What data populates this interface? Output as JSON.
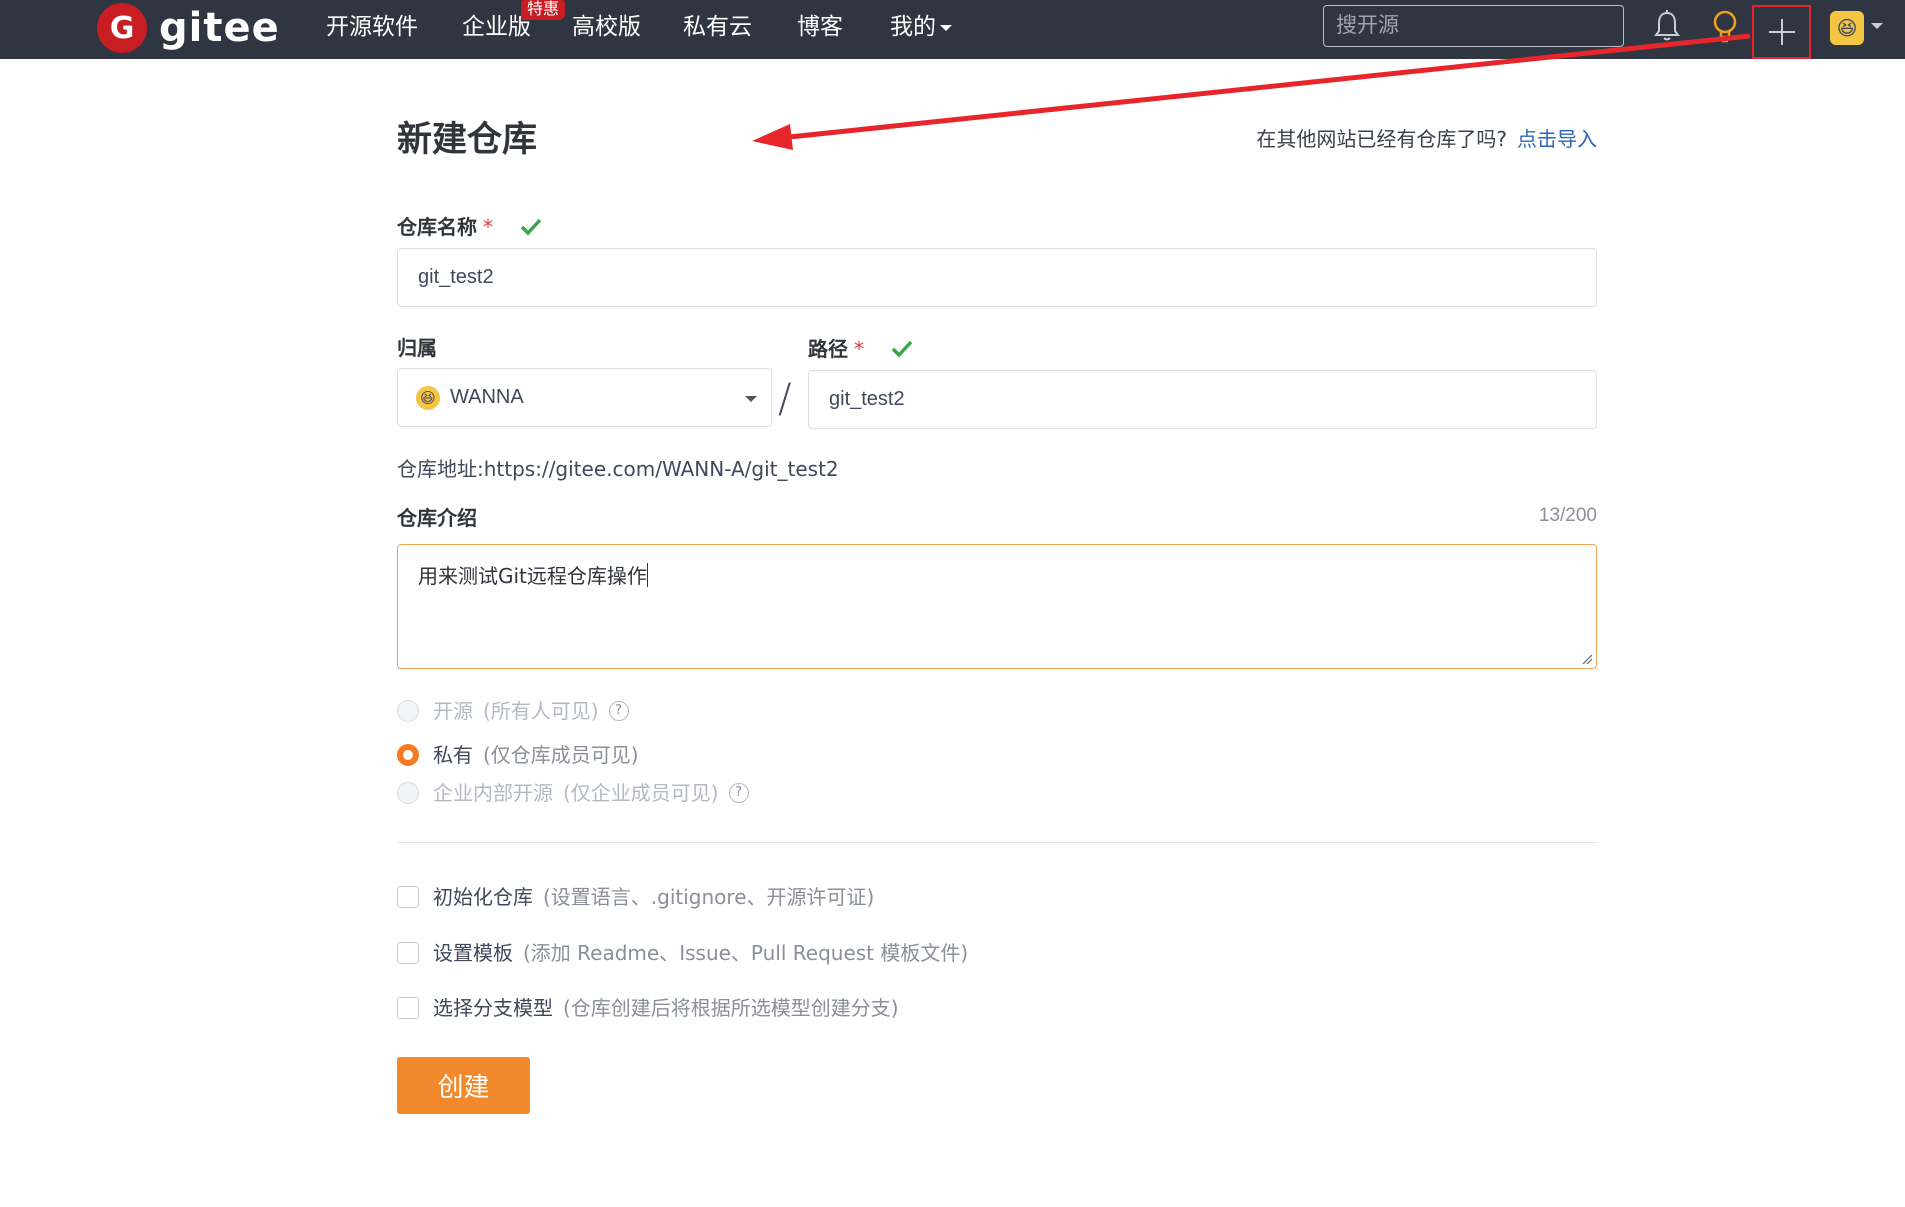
{
  "nav": {
    "logo_text": "gitee",
    "items": [
      "开源软件",
      "企业版",
      "高校版",
      "私有云",
      "博客",
      "我的"
    ],
    "badge": "特惠",
    "search_placeholder": "搜开源"
  },
  "page": {
    "title": "新建仓库",
    "import_prompt": "在其他网站已经有仓库了吗?",
    "import_link": "点击导入"
  },
  "form": {
    "repo_name_label": "仓库名称",
    "required_mark": "*",
    "repo_name_value": "git_test2",
    "owner_label": "归属",
    "owner_value": "WANNA",
    "path_label": "路径",
    "path_value": "git_test2",
    "separator": "/",
    "repo_url": "仓库地址:https://gitee.com/WANN-A/git_test2",
    "desc_label": "仓库介绍",
    "desc_counter": "13/200",
    "desc_value": "用来测试Git远程仓库操作"
  },
  "visibility": {
    "options": [
      {
        "label": "开源",
        "hint": "(所有人可见)",
        "selected": false,
        "disabled": true,
        "help": "?"
      },
      {
        "label": "私有",
        "hint": "(仅仓库成员可见)",
        "selected": true,
        "disabled": false
      },
      {
        "label": "企业内部开源",
        "hint": "(仅企业成员可见)",
        "selected": false,
        "disabled": true,
        "help": "?"
      }
    ]
  },
  "options": {
    "items": [
      {
        "label": "初始化仓库",
        "hint": "(设置语言、.gitignore、开源许可证)",
        "checked": false
      },
      {
        "label": "设置模板",
        "hint": "(添加 Readme、Issue、Pull Request 模板文件)",
        "checked": false
      },
      {
        "label": "选择分支模型",
        "hint": "(仓库创建后将根据所选模型创建分支)",
        "checked": false
      }
    ]
  },
  "create_button": "创建",
  "colors": {
    "nav_bg": "#2f3541",
    "brand_red": "#c71d23",
    "accent_orange": "#f28a2d",
    "link_blue": "#2d66b7",
    "annotation_red": "#e6262c",
    "check_green": "#3ea44a"
  },
  "icons": [
    "gitee-logo-icon",
    "bell-icon",
    "lightbulb-icon",
    "plus-icon",
    "avatar-emoji-icon",
    "check-icon",
    "help-icon"
  ]
}
